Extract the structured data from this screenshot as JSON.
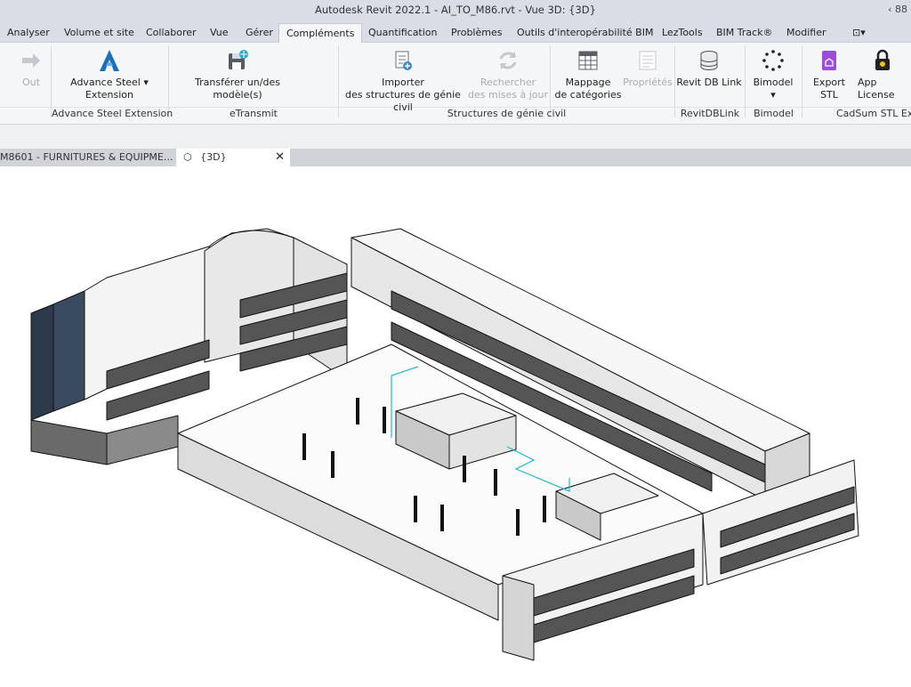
{
  "titlebar": {
    "title": "Autodesk Revit 2022.1 - AI_TO_M86.rvt - Vue 3D: {3D}",
    "right": "‹ 88"
  },
  "tabs": [
    "Analyser",
    "Volume et site",
    "Collaborer",
    "Vue",
    "Gérer",
    "Compléments",
    "Quantification",
    "Problèmes",
    "Outils d'interopérabilité BIM",
    "LezTools",
    "BIM Track®",
    "Modifier",
    "⊡▾"
  ],
  "active_tab": "Compléments",
  "ribbon": {
    "out": "Out",
    "advance_steel_1": "Advance Steel",
    "advance_steel_2": "Extension",
    "transferer": "Transférer un/des modèle(s)",
    "importer_1": "Importer",
    "importer_2": "des structures de génie civil",
    "rechercher_1": "Rechercher",
    "rechercher_2": "des mises à jour",
    "mappage_1": "Mappage",
    "mappage_2": "de catégories",
    "proprietes": "Propriétés",
    "revit_db_link": "Revit DB Link",
    "bimodel": "Bimodel",
    "export_stl": "Export STL",
    "app_license": "App License",
    "panels": {
      "advance_steel": "Advance Steel Extension",
      "etransmit": "eTransmit",
      "structures": "Structures de génie civil",
      "revitdblink": "RevitDBLink",
      "bimodel": "Bimodel",
      "cadsum": "CadSum STL Exp"
    }
  },
  "viewtabs": {
    "tab1": "M8601 - FURNITURES & EQUIPME...",
    "tab2": "{3D}",
    "close": "✕"
  },
  "colors": {
    "ribbon_bg": "#f5f6f7",
    "chrome": "#d9dee6",
    "accent_blue": "#1f6fb5",
    "bimtrack_purple": "#9b4fd6",
    "license_gold": "#f2c21b"
  }
}
